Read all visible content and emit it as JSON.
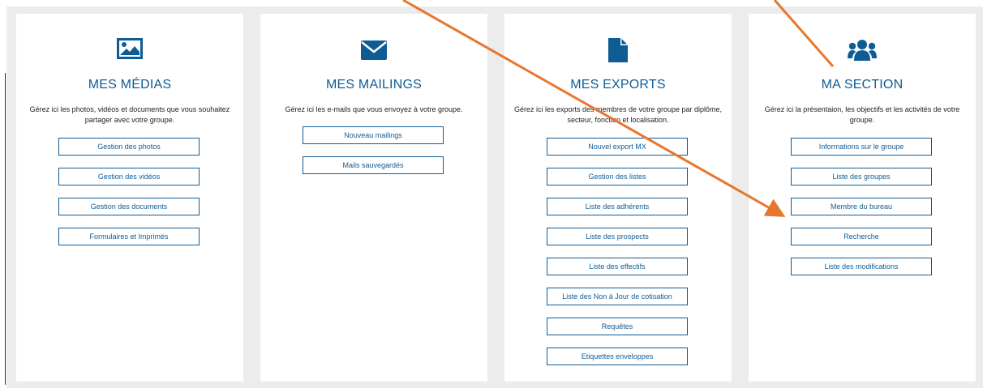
{
  "colors": {
    "accent": "#0f5c95",
    "annotation_arrow": "#e8772e",
    "panel_bg": "#ececec"
  },
  "cards": [
    {
      "icon": "image-icon",
      "title": "MES MÉDIAS",
      "description": "Gérez ici les photos, vidéos et documents que vous souhaitez partager avec votre groupe.",
      "buttons": [
        "Gestion des photos",
        "Gestion des vidéos",
        "Gestion des documents",
        "Formulaires et Imprimés"
      ]
    },
    {
      "icon": "envelope-icon",
      "title": "MES MAILINGS",
      "description": "Gérez ici les e-mails que vous envoyez à votre groupe.",
      "buttons": [
        "Nouveau mailings",
        "Mails sauvegardés"
      ]
    },
    {
      "icon": "document-icon",
      "title": "MES EXPORTS",
      "description": "Gérez ici les exports des membres de votre groupe par diplôme, secteur, fonction et localisation.",
      "buttons": [
        "Nouvel export MX",
        "Gestion des listes",
        "Liste des adhérents",
        "Liste des prospects",
        "Liste des effectifs",
        "Liste des Non à Jour de cotisation",
        "Requêtes",
        "Etiquettes enveloppes"
      ]
    },
    {
      "icon": "users-icon",
      "title": "MA SECTION",
      "description": "Gérez ici la présentaion, les objectifs et les activités de votre groupe.",
      "buttons": [
        "Informations sur le groupe",
        "Liste des groupes",
        "Membre du bureau",
        "Recherche",
        "Liste des modifications"
      ]
    }
  ]
}
